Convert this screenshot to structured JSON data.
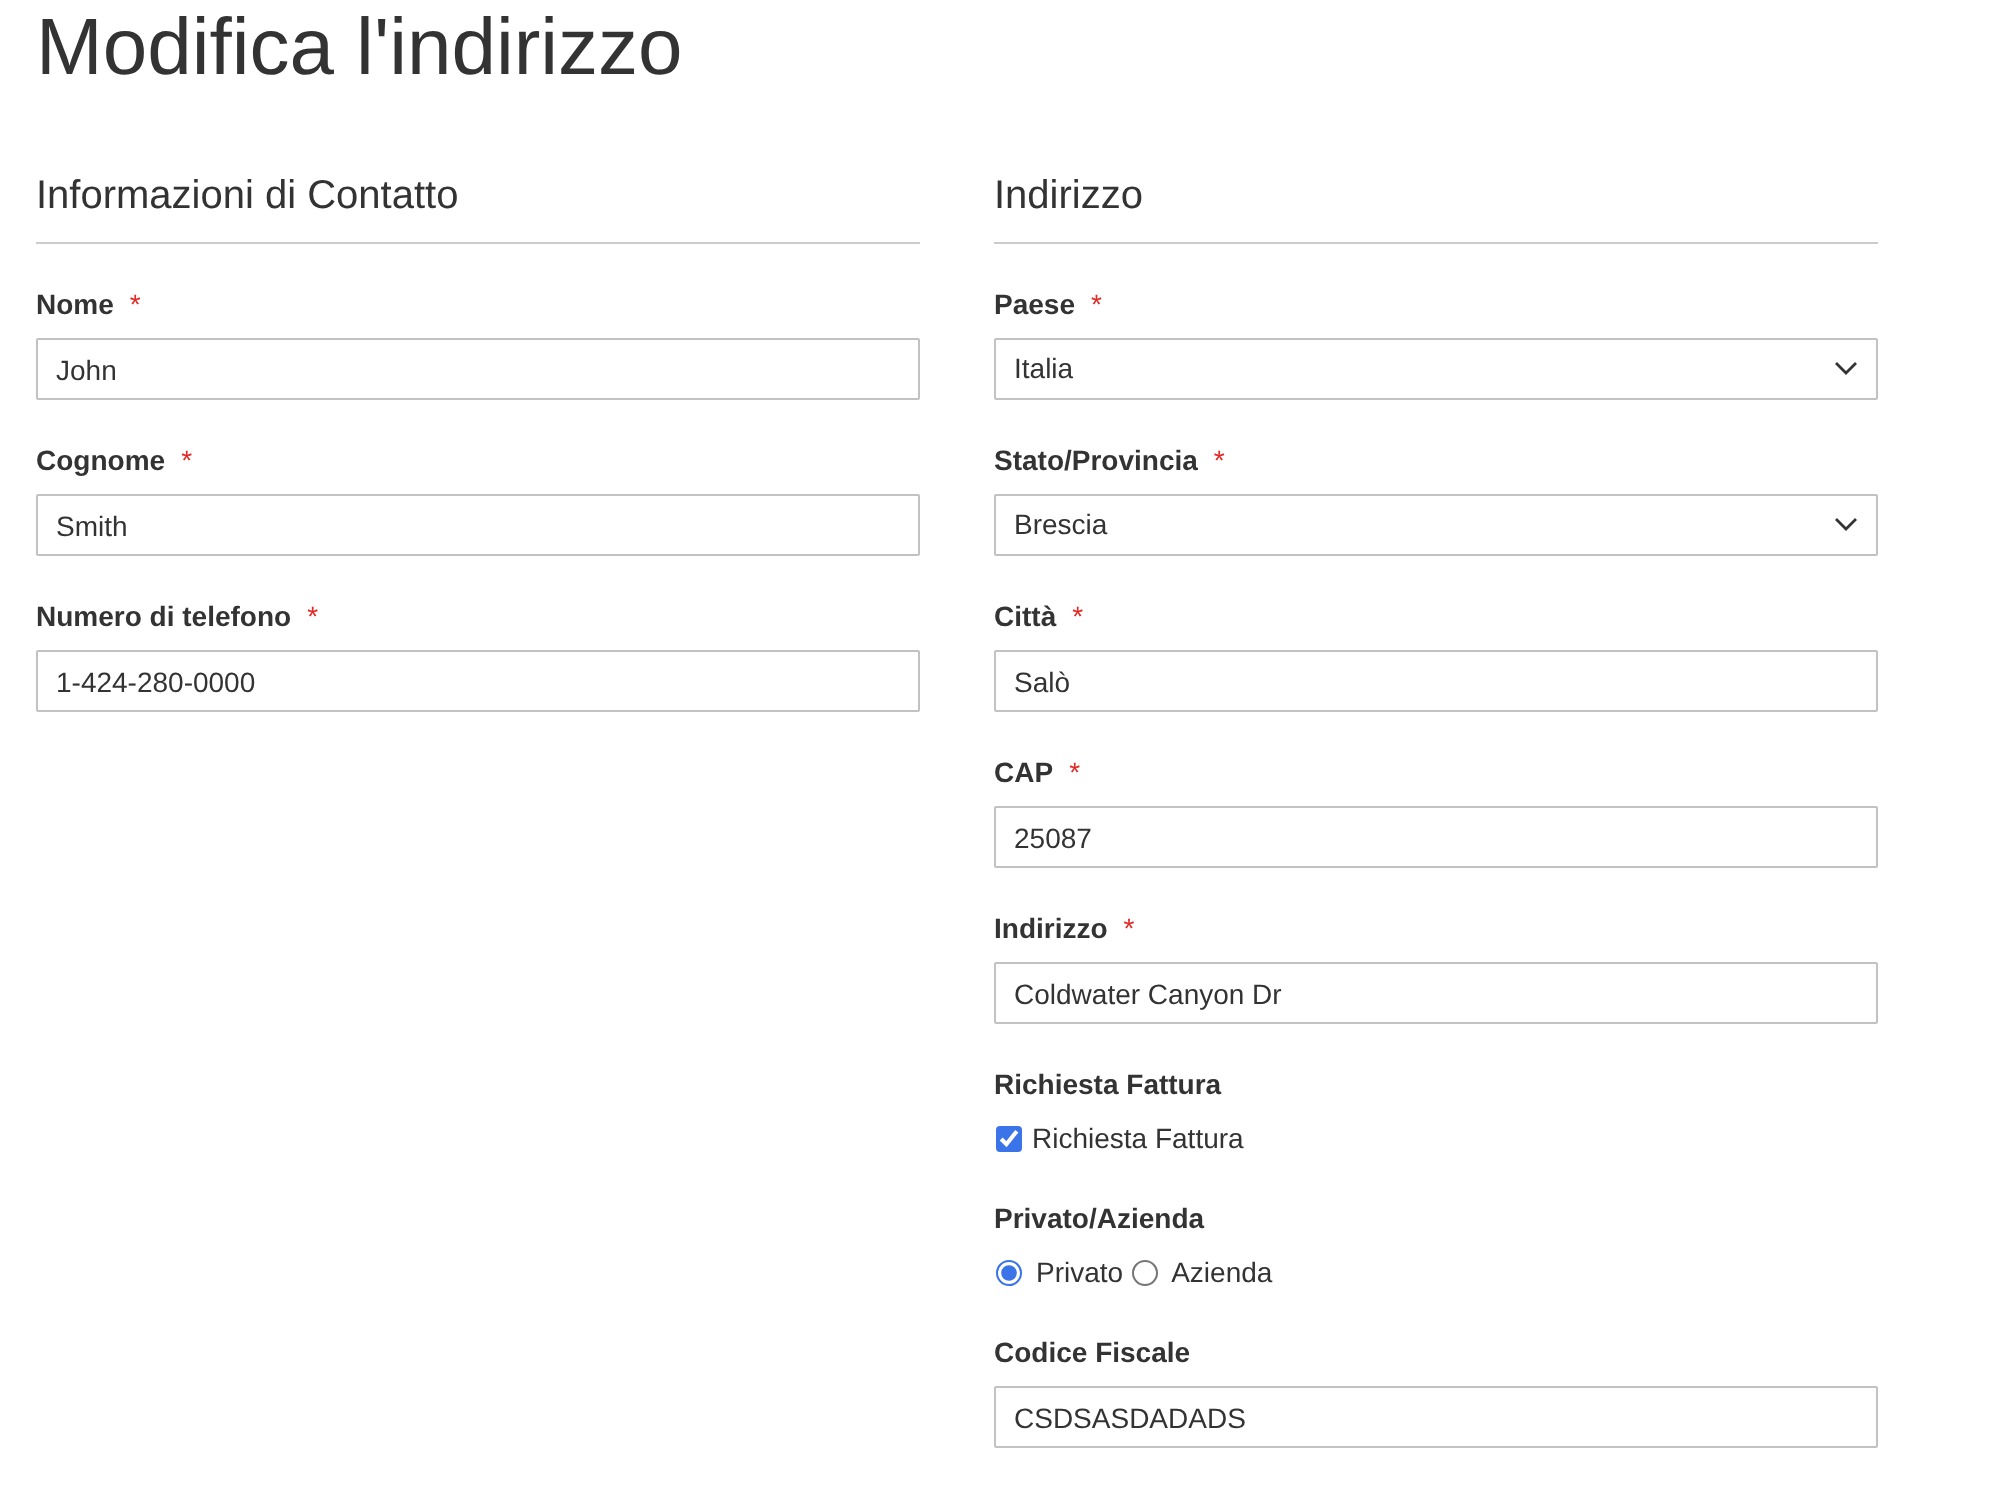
{
  "title": "Modifica l'indirizzo",
  "sections": [
    {
      "heading": "Informazioni di Contatto",
      "fields": [
        {
          "kind": "text",
          "label": "Nome",
          "required_mark": "*",
          "value": "John"
        },
        {
          "kind": "text",
          "label": "Cognome",
          "required_mark": "*",
          "value": "Smith"
        },
        {
          "kind": "text",
          "label": "Numero di telefono",
          "required_mark": "*",
          "value": "1-424-280-0000"
        }
      ]
    },
    {
      "heading": "Indirizzo",
      "fields": [
        {
          "kind": "select",
          "label": "Paese",
          "required_mark": "*",
          "value": "Italia"
        },
        {
          "kind": "select",
          "label": "Stato/Provincia",
          "required_mark": "*",
          "value": "Brescia"
        },
        {
          "kind": "text",
          "label": "Città",
          "required_mark": "*",
          "value": "Salò"
        },
        {
          "kind": "text",
          "label": "CAP",
          "required_mark": "*",
          "value": "25087"
        },
        {
          "kind": "text",
          "label": "Indirizzo",
          "required_mark": "*",
          "value": "Coldwater Canyon Dr"
        },
        {
          "kind": "checkbox",
          "label": "Richiesta Fattura",
          "options": [
            {
              "label": "Richiesta Fattura",
              "checked": true
            }
          ]
        },
        {
          "kind": "radio",
          "label": "Privato/Azienda",
          "options": [
            {
              "label": "Privato",
              "selected": true
            },
            {
              "label": "Azienda",
              "selected": false
            }
          ]
        },
        {
          "kind": "text",
          "label": "Codice Fiscale",
          "value": "CSDSASDADADS"
        }
      ]
    }
  ]
}
